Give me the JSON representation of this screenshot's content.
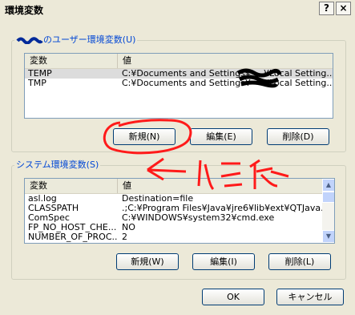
{
  "window": {
    "title": "環境変数",
    "help_label": "?",
    "close_label": "×"
  },
  "user_section": {
    "label_suffix": "のユーザー環境変数(U)",
    "columns": [
      "変数",
      "値"
    ],
    "rows": [
      {
        "name": "TEMP",
        "value": "C:¥Documents and Settings¥",
        "value_tail": "¥Local Setting..."
      },
      {
        "name": "TMP",
        "value": "C:¥Documents and Settings¥",
        "value_tail": "¥Local Setting..."
      }
    ],
    "buttons": {
      "new": "新規(N)",
      "edit": "編集(E)",
      "delete": "削除(D)"
    }
  },
  "system_section": {
    "label": "システム環境変数(S)",
    "columns": [
      "変数",
      "値"
    ],
    "rows": [
      {
        "name": "asl.log",
        "value": "Destination=file"
      },
      {
        "name": "CLASSPATH",
        "value": ".;C:¥Program Files¥Java¥jre6¥lib¥ext¥QTJava..."
      },
      {
        "name": "ComSpec",
        "value": "C:¥WINDOWS¥system32¥cmd.exe"
      },
      {
        "name": "FP_NO_HOST_CHE...",
        "value": "NO"
      },
      {
        "name": "NUMBER_OF_PROC...",
        "value": "2"
      }
    ],
    "buttons": {
      "new": "新規(W)",
      "edit": "編集(I)",
      "delete": "削除(L)"
    }
  },
  "footer": {
    "ok": "OK",
    "cancel": "キャンセル"
  },
  "annotation": {
    "text": "←これ",
    "color": "#ff0000"
  }
}
